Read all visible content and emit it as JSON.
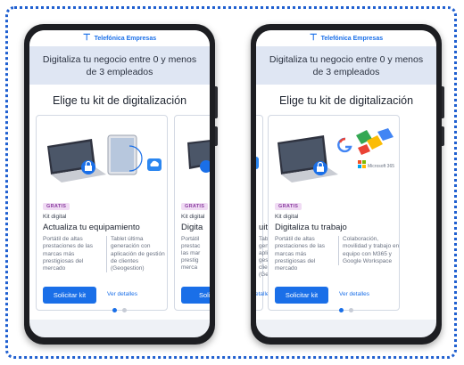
{
  "brand": {
    "name": "Telefónica Empresas",
    "color": "#1a6fe8"
  },
  "hero": {
    "text": "Digitaliza tu negocio entre 0 y menos de 3 empleados"
  },
  "section": {
    "title": "Elige tu kit de digitalización"
  },
  "phones": [
    {
      "card": {
        "badge": "GRATIS",
        "kit_label": "Kit digital",
        "title": "Actualiza tu equipamiento",
        "col1": "Portátil de altas prestaciones de las marcas más prestigiosas del mercado",
        "col2": "Tablet última generación con aplicación de gestión de clientes (Geogestion)",
        "cta": "Solicitar kit",
        "details": "Ver detalles",
        "icons": [
          "laptop-icon",
          "lock-icon",
          "tablet-icon",
          "cloud-upload-icon"
        ]
      },
      "next_card": {
        "badge": "GRATIS",
        "kit_label": "Kit digital",
        "title_fragment": "Digita",
        "col_fragment": [
          "Portátil",
          "prestac",
          "las mar",
          "prestig",
          "merca"
        ],
        "cta_fragment": "Solicit"
      }
    },
    {
      "prev_card": {
        "title_fragment": "uito",
        "col_fragment": [
          "Tablet",
          "generac",
          "aplicaci",
          "gestión",
          "clientes",
          "(Geoges"
        ],
        "details_fragment": "etalles"
      },
      "card": {
        "badge": "GRATIS",
        "kit_label": "Kit digital",
        "title": "Digitaliza tu trabajo",
        "col1": "Portátil de altas prestaciones de las marcas más prestigiosas del mercado",
        "col2": "Colaboración, movilidad y trabajo en equipo con M365 y Google Workspace",
        "cta": "Solicitar kit",
        "details": "Ver detalles",
        "logo_text": "Microsoft 365",
        "icons": [
          "laptop-icon",
          "lock-icon",
          "google-logo-icon",
          "microsoft-365-icon"
        ]
      }
    }
  ],
  "pagination": {
    "pages": 2,
    "active_left": 1,
    "active_right": 1
  }
}
